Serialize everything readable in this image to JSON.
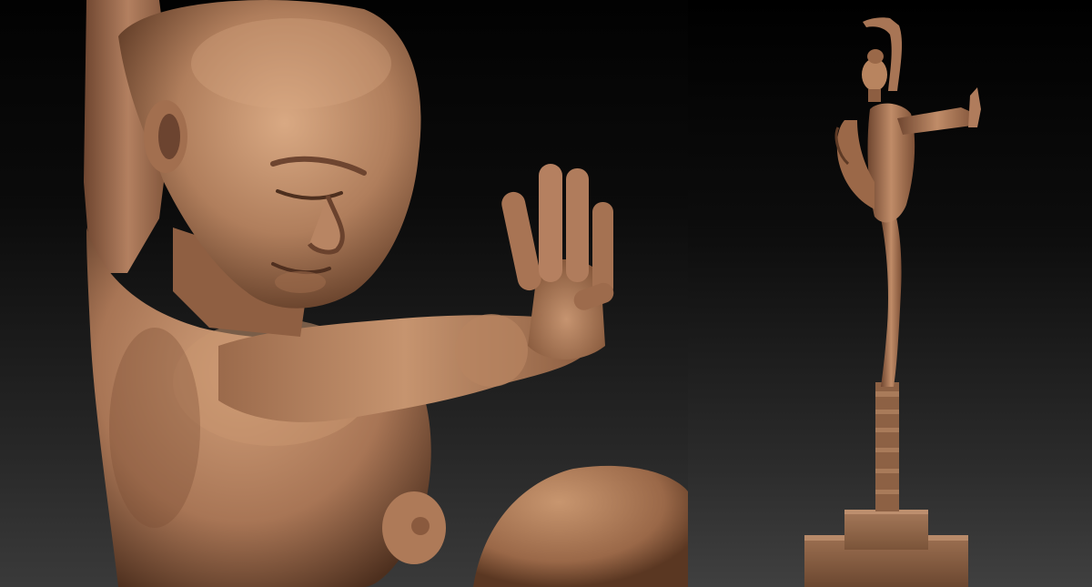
{
  "scene": {
    "description_colors": {
      "clay": "#b07e5c",
      "clay_light": "#d8a781",
      "clay_shadow": "#5e3a25",
      "background_top": "#030303",
      "background_bottom": "#3c3c3c"
    },
    "panels": [
      {
        "id": "closeup",
        "content": "sculpture-closeup"
      },
      {
        "id": "full-figure",
        "content": "sculpture-full-figure"
      }
    ]
  }
}
